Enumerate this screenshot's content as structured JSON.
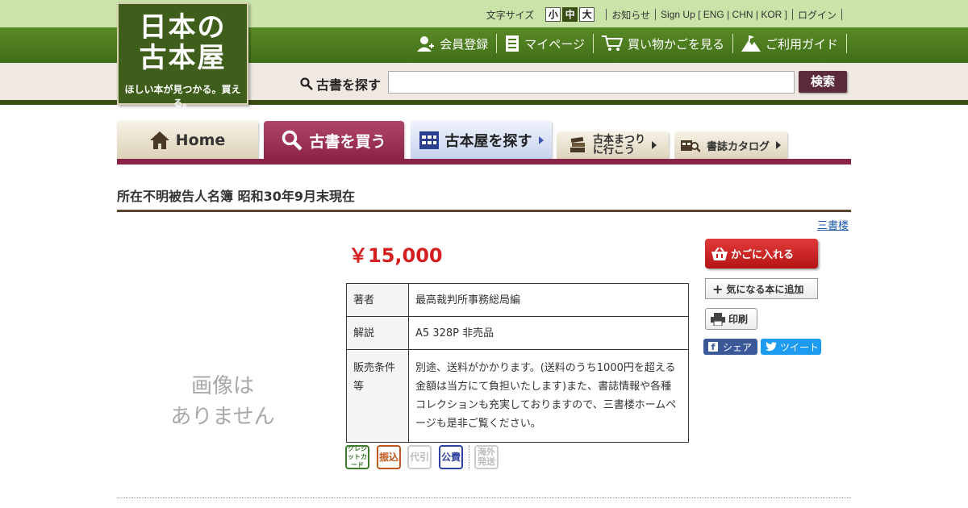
{
  "logo": {
    "line1": "日本の",
    "line2": "古本屋",
    "tagline": "ほしい本が見つかる。買える。"
  },
  "topbar": {
    "font_size_label": "文字サイズ",
    "font_sizes": [
      "小",
      "中",
      "大"
    ],
    "selected_font_size": "中",
    "links": [
      "お知らせ",
      "Sign Up [ ENG | CHN | KOR ]",
      "ログイン"
    ]
  },
  "mainnav": {
    "items": [
      {
        "label": "会員登録",
        "icon": "user-add-icon"
      },
      {
        "label": "マイページ",
        "icon": "document-icon"
      },
      {
        "label": "買い物かごを見る",
        "icon": "cart-icon"
      },
      {
        "label": "ご利用ガイド",
        "icon": "mountain-icon"
      }
    ]
  },
  "search": {
    "label": "古書を探す",
    "placeholder": "",
    "button": "検索"
  },
  "tabs": {
    "home": "Home",
    "buy": "古書を買う",
    "shop": "古本屋を探す",
    "fest_line1": "古本まつり",
    "fest_line2": "に行こう",
    "catalog": "書誌カタログ"
  },
  "product": {
    "title": "所在不明被告人名簿 昭和30年9月末現在",
    "seller": "三書楼",
    "no_image_line1": "画像は",
    "no_image_line2": "ありません",
    "price": "￥15,000",
    "details": [
      {
        "label": "著者",
        "value": "最高裁判所事務総局編"
      },
      {
        "label": "解説",
        "value": "A5 328P 非売品"
      },
      {
        "label": "販売条件等",
        "value": "別途、送料がかかります。(送料のうち1000円を超える金額は当方にて負担いたします)また、書誌情報や各種コレクションも充実しておりますので、三書楼ホームページも是非ご覧ください。"
      }
    ],
    "payment": {
      "card": "クレジットカード",
      "transfer": "振込",
      "cod": "代引",
      "public": "公費",
      "overseas_line1": "海外",
      "overseas_line2": "発送"
    }
  },
  "actions": {
    "cart": "かごに入れる",
    "favorite": "気になる本に追加",
    "print": "印刷",
    "share": "シェア",
    "tweet": "ツイート"
  },
  "colors": {
    "header_green": "#4e7e20",
    "accent_wine": "#8a2249",
    "price_red": "#d42020",
    "cart_red": "#c81e1e"
  }
}
